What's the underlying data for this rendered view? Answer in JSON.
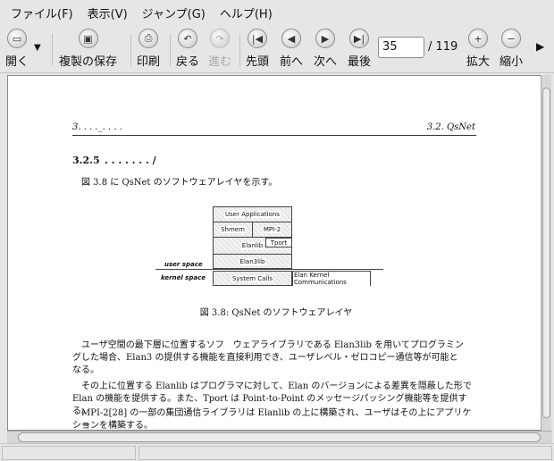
{
  "menu": {
    "file": "ファイル(F)",
    "view": "表示(V)",
    "jump": "ジャンプ(G)",
    "help": "ヘルプ(H)"
  },
  "toolbar": {
    "open": "開く",
    "save_copy": "複製の保存",
    "print": "印刷",
    "back": "戻る",
    "forward": "進む",
    "first": "先頭",
    "prev": "前へ",
    "next": "次へ",
    "last": "最後",
    "page_value": "35",
    "page_total": "/ 119",
    "zoom_in": "拡大",
    "zoom_out": "縮小"
  },
  "document": {
    "header_left": "3. . . ._. . . .",
    "header_right": "3.2. QsNet",
    "section_number": "3.2.5",
    "section_title": ". . . . . . . /",
    "intro": "図 3.8 に QsNet のソフトウェアレイヤを示す。",
    "figure": {
      "user_applications": "User Applications",
      "shmem": "Shmem",
      "mpi2": "MPI-2",
      "elanlib": "Elanlib",
      "tport": "Tport",
      "elan3lib": "Elan3lib",
      "system_calls": "System Calls",
      "elan_kernel": "Elan Kernel Communications",
      "user_space": "user space",
      "kernel_space": "kernel space"
    },
    "caption": "図 3.8: QsNet のソフトウェアレイヤ",
    "para1_line1": "ユーザ空間の最下層に位置するソフ　ウェアライブラリである Elan3lib を用いてプログラミン",
    "para1_line2": "グした場合、Elan3 の提供する機能を直接利用でき、ユーザレベル・ゼロコピー通信等が可能と",
    "para1_line3": "なる。",
    "para2_line1": "その上に位置する Elanlib はプログラマに対して、Elan のバージョンによる差異を隠蔽した形で",
    "para2_line2": "Elan の機能を提供する。また、Tport は Point-to-Point のメッセージパッシング機能等を提供する。",
    "para3_line1": "MPI-2[28] の一部の集団通信ライブラリは Elanlib の上に構築され、ユーザはその上にアプリケー",
    "para3_line2": "ションを構築する。"
  }
}
